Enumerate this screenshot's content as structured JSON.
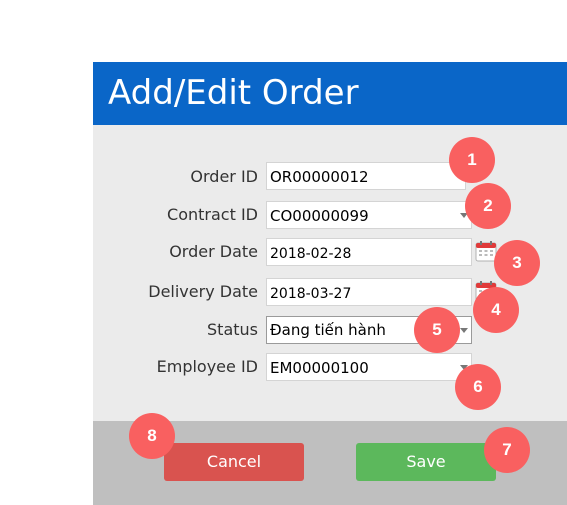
{
  "dialog": {
    "title": "Add/Edit Order"
  },
  "form": {
    "order_id": {
      "label": "Order ID",
      "value": "OR00000012"
    },
    "contract_id": {
      "label": "Contract ID",
      "value": "CO00000099"
    },
    "order_date": {
      "label": "Order Date",
      "value": "2018-02-28"
    },
    "delivery_date": {
      "label": "Delivery Date",
      "value": "2018-03-27"
    },
    "status": {
      "label": "Status",
      "value": "Đang tiến hành"
    },
    "employee_id": {
      "label": "Employee ID",
      "value": "EM00000100"
    }
  },
  "buttons": {
    "cancel": "Cancel",
    "save": "Save"
  },
  "annotations": [
    "1",
    "2",
    "3",
    "4",
    "5",
    "6",
    "7",
    "8"
  ],
  "colors": {
    "header": "#0a66c8",
    "cancel": "#d9534f",
    "save": "#5cb85c",
    "badge": "#f96060",
    "calendar": "#e03a3a"
  },
  "icons": {
    "calendar": "calendar-icon",
    "dropdown": "chevron-down-icon"
  }
}
